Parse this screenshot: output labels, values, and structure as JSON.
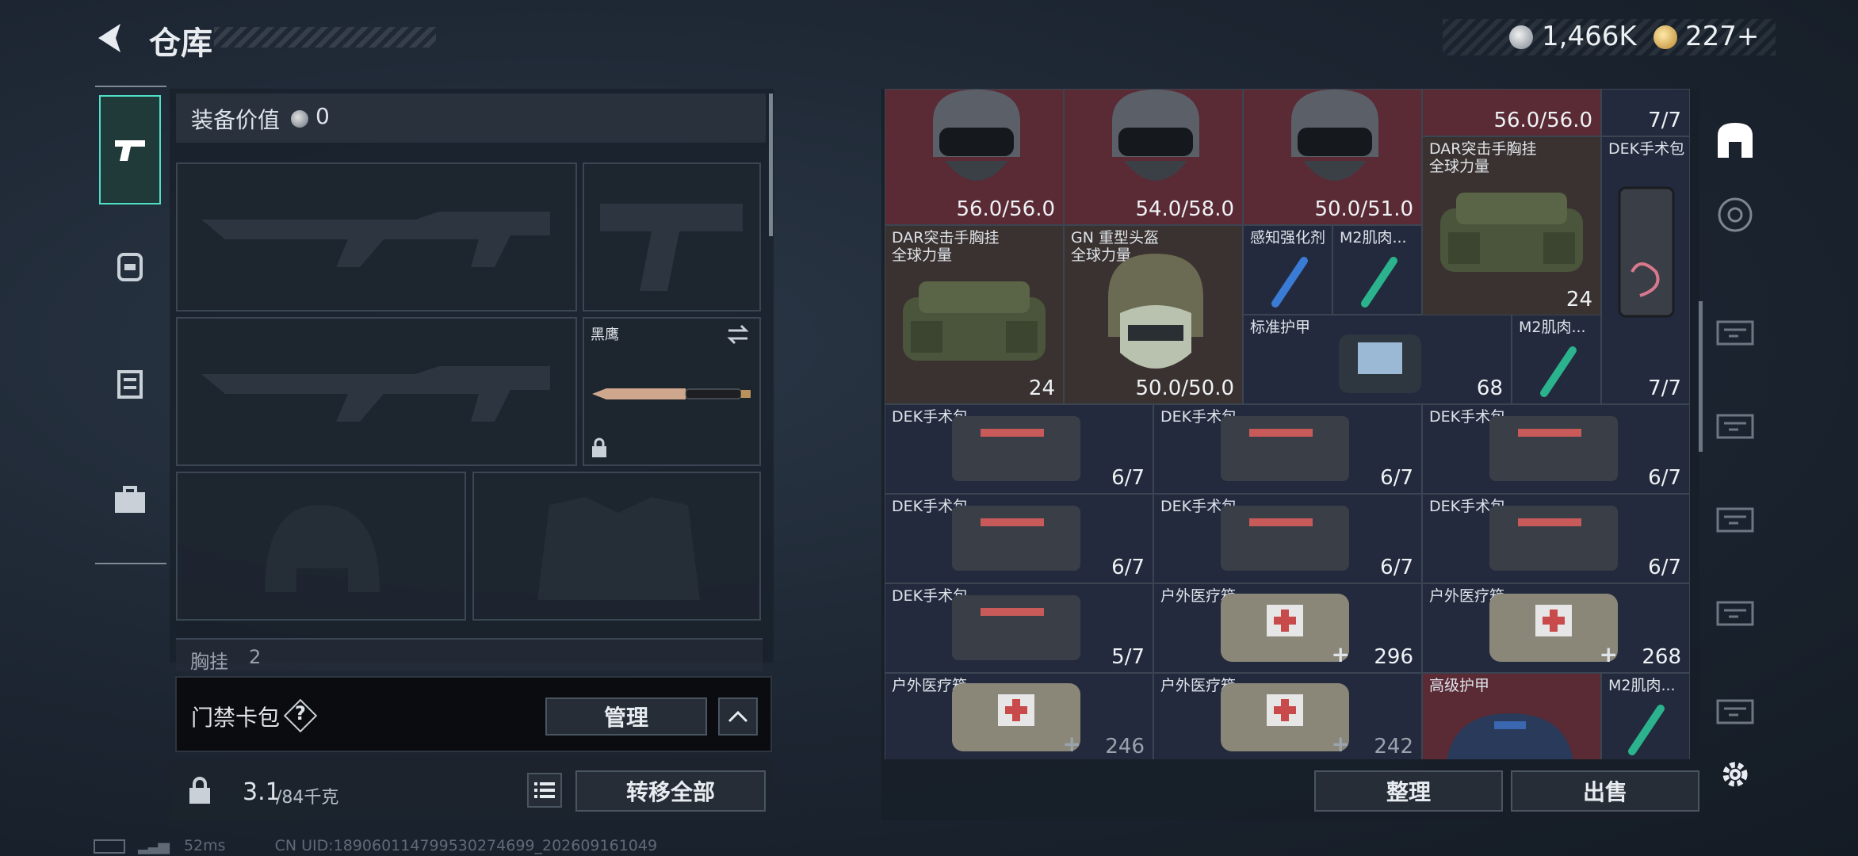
{
  "header": {
    "title": "仓库",
    "silver": "1,466K",
    "gold": "227+"
  },
  "loadout": {
    "value_label": "装备价值",
    "value": "0",
    "knife_name": "黑鹰",
    "chest_label": "胸挂",
    "chest_count": "2"
  },
  "keycard": {
    "label": "门禁卡包",
    "help": "?",
    "manage": "管理"
  },
  "footer": {
    "weight": "3.1",
    "capacity": "/84千克",
    "transfer_all": "转移全部",
    "organize": "整理",
    "sell": "出售"
  },
  "inventory": {
    "items": [
      {
        "name": "",
        "count": "56.0/56.0",
        "bg": "red"
      },
      {
        "name": "",
        "count": "54.0/58.0",
        "bg": "red"
      },
      {
        "name": "",
        "count": "50.0/51.0",
        "bg": "red"
      },
      {
        "name": "",
        "count": "56.0/56.0",
        "bg": "red"
      },
      {
        "name": "",
        "count": "7/7",
        "bg": "navy"
      },
      {
        "name": "DAR突击手胸挂\n全球力量",
        "count": "24",
        "bg": "brown"
      },
      {
        "name": "DEK手术包",
        "count": "7/7",
        "bg": "navy"
      },
      {
        "name": "DAR突击手胸挂\n全球力量",
        "count": "24",
        "bg": "brown"
      },
      {
        "name": "GN 重型头盔\n全球力量",
        "count": "50.0/50.0",
        "bg": "brown"
      },
      {
        "name": "感知强化剂",
        "count": "",
        "bg": "navy"
      },
      {
        "name": "M2肌肉...",
        "count": "",
        "bg": "navy"
      },
      {
        "name": "标准护甲",
        "count": "68",
        "bg": "navy"
      },
      {
        "name": "M2肌肉...",
        "count": "",
        "bg": "navy"
      },
      {
        "name": "DEK手术包",
        "count": "6/7",
        "bg": "navy"
      },
      {
        "name": "DEK手术包",
        "count": "6/7",
        "bg": "navy"
      },
      {
        "name": "DEK手术包",
        "count": "6/7",
        "bg": "navy"
      },
      {
        "name": "DEK手术包",
        "count": "6/7",
        "bg": "navy"
      },
      {
        "name": "DEK手术包",
        "count": "6/7",
        "bg": "navy"
      },
      {
        "name": "DEK手术包",
        "count": "6/7",
        "bg": "navy"
      },
      {
        "name": "DEK手术包",
        "count": "5/7",
        "bg": "navy"
      },
      {
        "name": "户外医疗箱",
        "count": "296",
        "bg": "navy"
      },
      {
        "name": "户外医疗箱",
        "count": "268",
        "bg": "navy"
      },
      {
        "name": "户外医疗箱",
        "count": "246",
        "bg": "navy"
      },
      {
        "name": "户外医疗箱",
        "count": "242",
        "bg": "navy"
      },
      {
        "name": "高级护甲",
        "count": "",
        "bg": "red"
      },
      {
        "name": "M2肌肉...",
        "count": "",
        "bg": "navy"
      }
    ]
  },
  "status": {
    "ping": "52ms",
    "uid": "CN UID:18906011479953027469­9_202609161049"
  },
  "colors": {
    "accent": "#4fe0c7",
    "panel": "#1e2632",
    "red_bg": "#5a2a35"
  }
}
